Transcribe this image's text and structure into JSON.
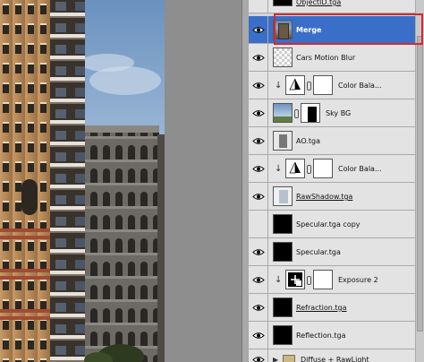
{
  "layers": [
    {
      "name": "ObjectID.tga",
      "kind": "image",
      "thumb": "dark"
    },
    {
      "name": "Merge",
      "kind": "image",
      "thumb": "merge",
      "selected": true
    },
    {
      "name": "Cars Motion Blur",
      "kind": "image",
      "thumb": "checker"
    },
    {
      "name": "Color Bala...",
      "kind": "adjustment",
      "adjustment": "color-balance"
    },
    {
      "name": "Sky BG",
      "kind": "image",
      "thumb": "sky",
      "mask": true
    },
    {
      "name": "AO.tga",
      "kind": "image",
      "thumb": "ao"
    },
    {
      "name": "Color Bala...",
      "kind": "adjustment",
      "adjustment": "color-balance"
    },
    {
      "name": "RawShadow.tga",
      "kind": "image",
      "thumb": "shadow"
    },
    {
      "name": "Specular.tga copy",
      "kind": "image",
      "thumb": "dark"
    },
    {
      "name": "Specular.tga",
      "kind": "image",
      "thumb": "dark"
    },
    {
      "name": "Exposure 2",
      "kind": "adjustment",
      "adjustment": "exposure"
    },
    {
      "name": "Refraction.tga",
      "kind": "image",
      "thumb": "dark"
    },
    {
      "name": "Reflection.tga",
      "kind": "image",
      "thumb": "dark"
    },
    {
      "name": "Diffuse + RawLight",
      "kind": "group"
    }
  ],
  "colors": {
    "selected_row": "#3a6fc9",
    "selection_outline": "#d8262e",
    "panel_bg": "#e3e3e3"
  },
  "icons": {
    "visibility": "eye-icon",
    "link": "chain-link-icon",
    "group": "folder-icon",
    "expand": "triangle-right-icon"
  }
}
